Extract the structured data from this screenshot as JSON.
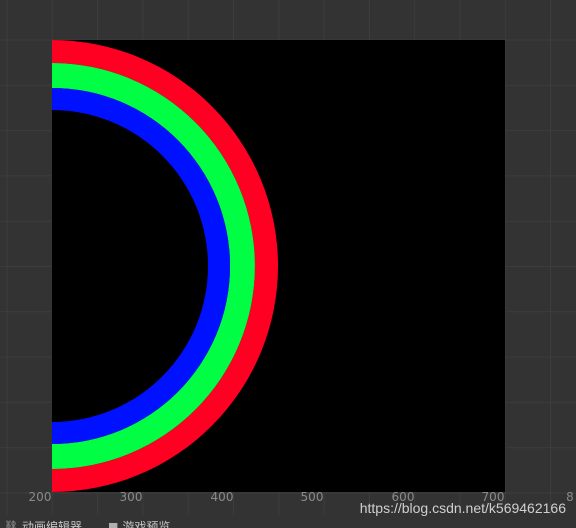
{
  "scene": {
    "background_color": "#333333",
    "grid_color": "#3d3d3d",
    "canvas_color": "#000000",
    "rings": [
      {
        "name": "red-ring",
        "color": "#ff0022"
      },
      {
        "name": "green-ring",
        "color": "#00ff44"
      },
      {
        "name": "blue-ring",
        "color": "#0011ff"
      }
    ]
  },
  "ruler": {
    "labels": [
      "200",
      "300",
      "400",
      "500",
      "600",
      "700",
      "8"
    ]
  },
  "tabs": [
    {
      "label": "动画编辑器",
      "icon": "animation-icon"
    },
    {
      "label": "游戏预览",
      "icon": "game-preview-icon"
    }
  ],
  "watermark": "https://blog.csdn.net/k569462166"
}
